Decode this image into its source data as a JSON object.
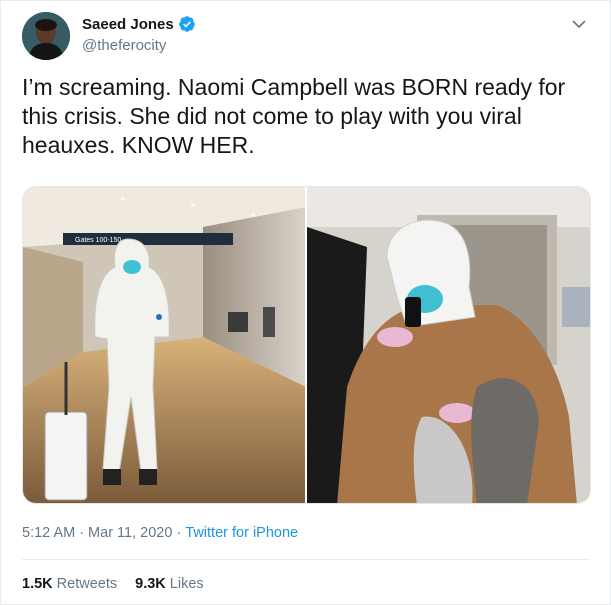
{
  "author": {
    "name": "Saeed Jones",
    "handle": "@theferocity",
    "verified": true
  },
  "tweet": {
    "lines": [
      "I’m screaming. Naomi Campbell was BORN ready for",
      "this crisis. She did not come to play with you viral",
      "heauxes. KNOW HER."
    ]
  },
  "photos": [
    {
      "signage_text": "Gates 100-150"
    },
    {}
  ],
  "meta": {
    "time": "5:12 AM",
    "separator": "·",
    "date": "Mar 11, 2020",
    "source": "Twitter for iPhone"
  },
  "stats": {
    "retweets_count": "1.5K",
    "retweets_label": "Retweets",
    "likes_count": "9.3K",
    "likes_label": "Likes"
  },
  "colors": {
    "verified": "#1da1f2",
    "link": "#1b95e0",
    "secondary_text": "#657786"
  },
  "icons": [
    "verified-badge-icon",
    "chevron-down-icon"
  ]
}
